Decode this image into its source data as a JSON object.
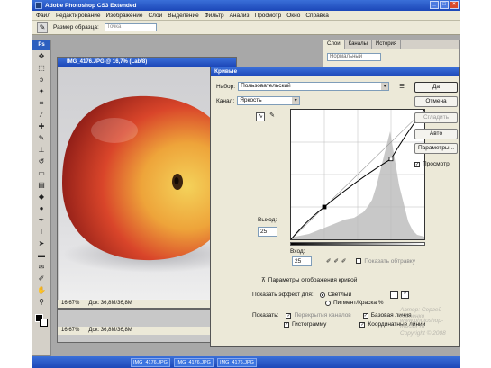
{
  "window": {
    "title": "Adobe Photoshop CS3 Extended"
  },
  "menu": [
    "Файл",
    "Редактирование",
    "Изображение",
    "Слой",
    "Выделение",
    "Фильтр",
    "Анализ",
    "Просмотр",
    "Окно",
    "Справка"
  ],
  "options_bar": {
    "label": "Размер образца:",
    "value": "Точка"
  },
  "palette": {
    "tabs": [
      "Слои",
      "Каналы",
      "История"
    ],
    "select": "Нормальный"
  },
  "toolbox": {
    "header": "Ps"
  },
  "image_window": {
    "title": "IMG_4176.JPG @ 16,7% (Lab/8)",
    "zoom": "16,67%",
    "doc": "Док: 36,8М/36,8М"
  },
  "image_window2": {
    "zoom": "16,67%",
    "doc": "Док: 36,8М/36,8М"
  },
  "curves": {
    "title": "Кривые",
    "preset_label": "Набор:",
    "preset_value": "Пользовательский",
    "channel_label": "Канал:",
    "channel_value": "Яркость",
    "output_label": "Выход:",
    "output_value": "25",
    "input_label": "Вход:",
    "input_value": "25",
    "show_clipping": "Показать обтравку",
    "display_options": "Параметры отображения кривой",
    "show_amount_label": "Показать эффект для:",
    "light_option": "Светлый",
    "pigment_option": "Пигмент/Краска %",
    "show_label": "Показать:",
    "channel_overlays": "Перекрытия каналов",
    "baseline": "Базовая линия",
    "histogram": "Гистограмму",
    "intersection": "Координатные линии",
    "buttons": {
      "ok": "Да",
      "cancel": "Отмена",
      "smooth": "Сгладить",
      "auto": "Авто",
      "options": "Параметры...",
      "preview": "Просмотр"
    },
    "curve_points": [
      [
        0,
        0
      ],
      [
        25,
        25
      ],
      [
        75,
        62
      ],
      [
        100,
        100
      ]
    ],
    "histogram_color": "#c8c8c8"
  },
  "watermark": [
    "Автор: Сергей Хатенко",
    "www.photoshop-master.ru",
    "Copyright © 2008"
  ],
  "taskbar": {
    "tasks": [
      "IMG_4176.JPG",
      "IMG_4176.JPG",
      "IMG_4176.JPG"
    ]
  },
  "colors": {
    "xp_blue": "#1c47b8",
    "dialog_bg": "#ece9d8"
  }
}
